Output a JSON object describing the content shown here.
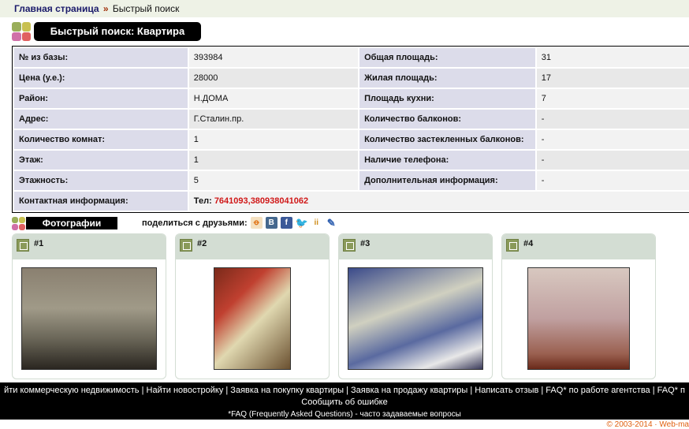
{
  "breadcrumb": {
    "home": "Главная страница",
    "sep": "»",
    "current": "Быстрый поиск"
  },
  "title": "Быстрый поиск: Квартира",
  "rows": [
    {
      "l": "№ из базы:",
      "v": "393984",
      "l2": "Общая площадь:",
      "v2": "31"
    },
    {
      "l": "Цена (у.е.):",
      "v": "28000",
      "l2": "Жилая площадь:",
      "v2": "17"
    },
    {
      "l": "Район:",
      "v": "Н.ДОМА",
      "l2": "Площадь кухни:",
      "v2": "7"
    },
    {
      "l": "Адрес:",
      "v": "Г.Сталин.пр.",
      "l2": "Количество балконов:",
      "v2": "-"
    },
    {
      "l": "Количество комнат:",
      "v": "1",
      "l2": "Количество застекленных балконов:",
      "v2": "-"
    },
    {
      "l": "Этаж:",
      "v": "1",
      "l2": "Наличие телефона:",
      "v2": "-"
    },
    {
      "l": "Этажность:",
      "v": "5",
      "l2": "Дополнительная информация:",
      "v2": "-"
    }
  ],
  "contact": {
    "label": "Контактная информация:",
    "tel_label": "Тел:",
    "tel": "7641093,380938041062"
  },
  "photos_title": "Фотографии",
  "share_label": "поделиться с друзьями:",
  "photos": [
    {
      "label": "#1"
    },
    {
      "label": "#2"
    },
    {
      "label": "#3"
    },
    {
      "label": "#4"
    }
  ],
  "footer": {
    "links": "йти коммерческую недвижимость | Найти новостройку | Заявка на покупку квартиры | Заявка на продажу квартиры | Написать отзыв | FAQ* по работе агентства | FAQ* п",
    "report": "Сообщить об ошибке",
    "faq_note": "*FAQ (Frequently Asked Questions) - часто задаваемые вопросы",
    "copyright": "© 2003-2014 · Web-ma"
  }
}
